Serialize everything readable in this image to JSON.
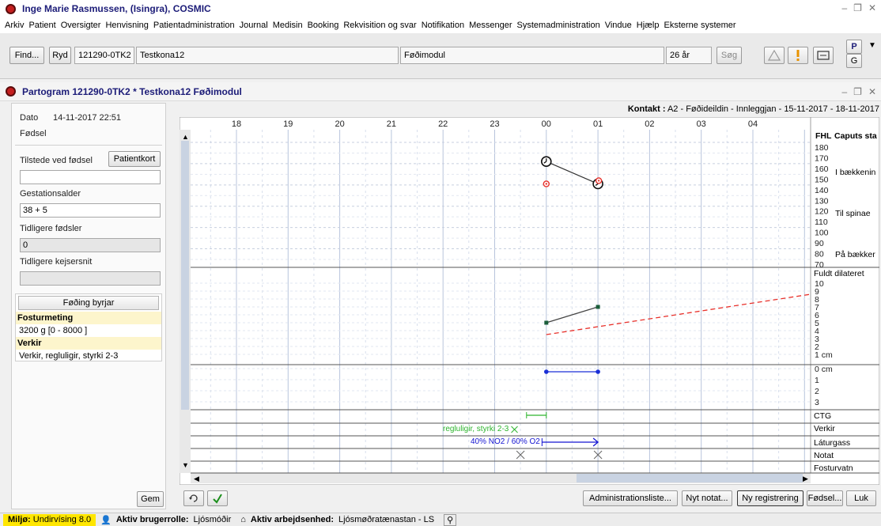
{
  "window": {
    "title": "Inge Marie Rasmussen, (Isingra), COSMIC"
  },
  "menu": [
    "Arkiv",
    "Patient",
    "Oversigter",
    "Henvisning",
    "Patientadministration",
    "Journal",
    "Medisin",
    "Booking",
    "Rekvisition og svar",
    "Notifikation",
    "Messenger",
    "Systemadministration",
    "Vindue",
    "Hjælp",
    "Eksterne systemer"
  ],
  "toolbar": {
    "find_label": "Find...",
    "ryd_label": "Ryd",
    "patient_id": "121290-0TK2",
    "patient_name": "Testkona12",
    "module": "Føðimodul",
    "age": "26 år",
    "search_label": "Søg",
    "p_label": "P",
    "g_label": "G"
  },
  "partogram": {
    "title": "Partogram 121290-0TK2 * Testkona12 Føðimodul"
  },
  "left": {
    "dato_label": "Dato",
    "dato_value": "14-11-2017 22:51",
    "fodsel_label": "Fødsel",
    "tilstede_label": "Tilstede ved fødsel",
    "patientkort_label": "Patientkort",
    "tilstede_value": "",
    "gestation_label": "Gestationsalder",
    "gestation_value": "38 + 5",
    "tidl_fodsler_label": "Tidligere fødsler",
    "tidl_fodsler_value": "0",
    "tidl_kejser_label": "Tidligere kejsersnit",
    "tidl_kejser_value": "",
    "foding_header": "Føðing byrjar",
    "fostur_header": "Fosturmeting",
    "fostur_value": "3200 g [0 - 8000 ]",
    "verkir_header": "Verkir",
    "verkir_value": "Verkir, regluligir, styrki 2-3",
    "gem_label": "Gem"
  },
  "contact": {
    "label": "Kontakt :",
    "value": "A2 - Føðideildin - Innleggjan - 15-11-2017 - 18-11-2017"
  },
  "chart": {
    "hours": [
      "18",
      "19",
      "20",
      "21",
      "22",
      "23",
      "00",
      "01",
      "02",
      "03",
      "04"
    ],
    "fhl_header": "FHL",
    "caputs_header": "Caputs sta",
    "fhl_ticks": [
      "180",
      "170",
      "160",
      "150",
      "140",
      "130",
      "120",
      "110",
      "100",
      "90",
      "80",
      "70"
    ],
    "caputs_labels": [
      "I bækkenin",
      "Til spinae",
      "På bækker"
    ],
    "dilation_header": "Fuldt dilateret",
    "dilation_ticks": [
      "10",
      "9",
      "8",
      "7",
      "6",
      "5",
      "4",
      "3",
      "2",
      "1 cm"
    ],
    "station_ticks": [
      "0 cm",
      "1",
      "2",
      "3"
    ],
    "rows": [
      "CTG",
      "Verkir",
      "Láturgass",
      "Notat",
      "Fosturvatn"
    ],
    "verkir_text": "regluligir, styrki 2-3",
    "laturgass_text": "40% NO2 / 60% O2",
    "colors": {
      "verkir": "#2db52d",
      "laturgass": "#1414d2",
      "alert": "#e8302a"
    }
  },
  "chart_data": {
    "type": "line",
    "series": [
      {
        "points": [
          {
            "x": "00:00",
            "y": 162
          },
          {
            "x": "01:00",
            "y": 141
          }
        ]
      },
      {
        "points": [
          {
            "x": "00:00",
            "y": 5
          },
          {
            "x": "01:00",
            "y": 7
          }
        ]
      },
      {
        "points": [
          {
            "x": "00:00",
            "y": 0
          },
          {
            "x": "01:00",
            "y": 0
          }
        ]
      }
    ]
  },
  "buttons": {
    "admin_list": "Administrationsliste...",
    "nyt_notat": "Nyt notat...",
    "ny_reg": "Ny registrering",
    "fodsel": "Fødsel...",
    "luk": "Luk"
  },
  "status": {
    "miljo_label": "Miljø:",
    "miljo_value": "Undirvísing 8.0",
    "rolle_label": "Aktiv brugerrolle:",
    "rolle_value": "Ljósmóðir",
    "enhed_label": "Aktiv arbejdsenhed:",
    "enhed_value": "Ljósmøðratænastan - LS"
  }
}
